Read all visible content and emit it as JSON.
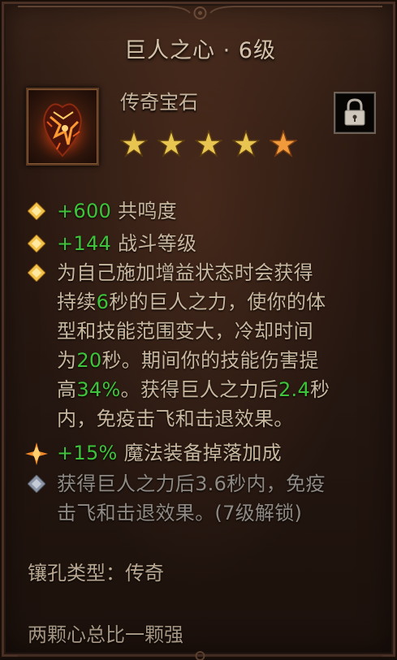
{
  "tooltip": {
    "title": "巨人之心 · 6级",
    "rarity": "传奇宝石",
    "star_rating": {
      "filled": 4,
      "highlighted": 1,
      "total": 5
    },
    "icons": {
      "gem": "giant-heart-gem-icon",
      "lock": "padlock-icon",
      "bullet_active": "gold-diamond-icon",
      "bullet_bonus": "burst-diamond-icon",
      "bullet_locked": "gray-diamond-icon"
    },
    "stats": [
      {
        "value": "+600",
        "label": " 共鸣度"
      },
      {
        "value": "+144",
        "label": " 战斗等级"
      }
    ],
    "effect": {
      "l1": "为自己施加增益状态时会获得",
      "l2a": "持续",
      "l2b": "6",
      "l2c": "秒的巨人之力，使你的体",
      "l3": "型和技能范围变大，冷却时间",
      "l4a": "为",
      "l4b": "20",
      "l4c": "秒。期间你的技能伤害提",
      "l5a": "高",
      "l5b": "34%",
      "l5c": "。获得巨人之力后",
      "l5d": "2.4",
      "l5e": "秒",
      "l6": "内，免疫击飞和击退效果。"
    },
    "bonus": {
      "value": "+15%",
      "label": " 魔法装备掉落加成"
    },
    "locked": {
      "l1": "获得巨人之力后3.6秒内，免疫",
      "l2": "击飞和击退效果。(7级解锁)"
    },
    "socket_type": "镶孔类型：传奇",
    "flavor": "两颗心总比一颗强"
  },
  "colors": {
    "highlight_green": "#3ec43a",
    "body_text": "#c9b8a0",
    "locked_text": "#8f8a84",
    "star_gold": "#e8c450",
    "star_orange": "#f09a3c"
  }
}
